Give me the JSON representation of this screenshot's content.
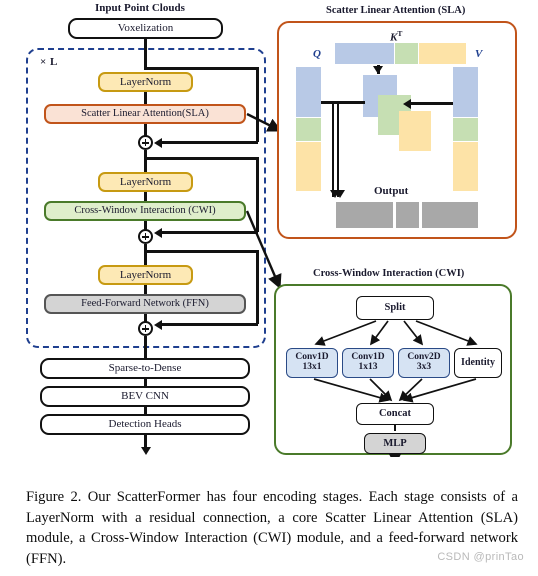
{
  "figure": {
    "input_label": "Input Point Clouds",
    "stage_repeat": "× L",
    "caption": "Figure 2. Our ScatterFormer has four encoding stages. Each stage consists of a LayerNorm with a residual connection, a core Scatter Linear Attention (SLA) module, a Cross-Window Interaction (CWI) module, and a feed-forward network (FFN).",
    "watermark": "CSDN @prinTao"
  },
  "pipeline": {
    "voxelization": "Voxelization",
    "layernorm_1": "LayerNorm",
    "sla_block": "Scatter Linear Attention(SLA)",
    "layernorm_2": "LayerNorm",
    "cwi_block": "Cross-Window Interaction (CWI)",
    "layernorm_3": "LayerNorm",
    "ffn_block": "Feed-Forward Network (FFN)",
    "sparse_to_dense": "Sparse-to-Dense",
    "bev_cnn": "BEV CNN",
    "detection_heads": "Detection Heads"
  },
  "sla_panel": {
    "title": "Scatter Linear Attention (SLA)",
    "q_label": "Q",
    "kt_label": "K",
    "kt_sup": "T",
    "v_label": "V",
    "output_label": "Output",
    "border_color": "#c1541a",
    "colors": {
      "blue": "#b8c9e6",
      "green": "#c6dfb3",
      "yellow": "#fde3a7",
      "gray": "#a8a8a8"
    }
  },
  "cwi_panel": {
    "title": "Cross-Window Interaction (CWI)",
    "split": "Split",
    "branches": [
      {
        "name": "Conv1D",
        "kernel": "13x1",
        "style": "blue"
      },
      {
        "name": "Conv1D",
        "kernel": "1x13",
        "style": "blue"
      },
      {
        "name": "Conv2D",
        "kernel": "3x3",
        "style": "blue"
      },
      {
        "name": "Identity",
        "kernel": "",
        "style": "plain"
      }
    ],
    "concat": "Concat",
    "mlp": "MLP",
    "border_color": "#4a7a2a"
  },
  "colors": {
    "layernorm_fill": "#fde9b5",
    "layernorm_border": "#c79a12",
    "sla_fill": "#fae2d5",
    "sla_border": "#c1541a",
    "cwi_fill": "#dfeecb",
    "cwi_border": "#4a7a2a",
    "ffn_fill": "#d4d4d4",
    "stage_dash": "#1f3f8f"
  }
}
